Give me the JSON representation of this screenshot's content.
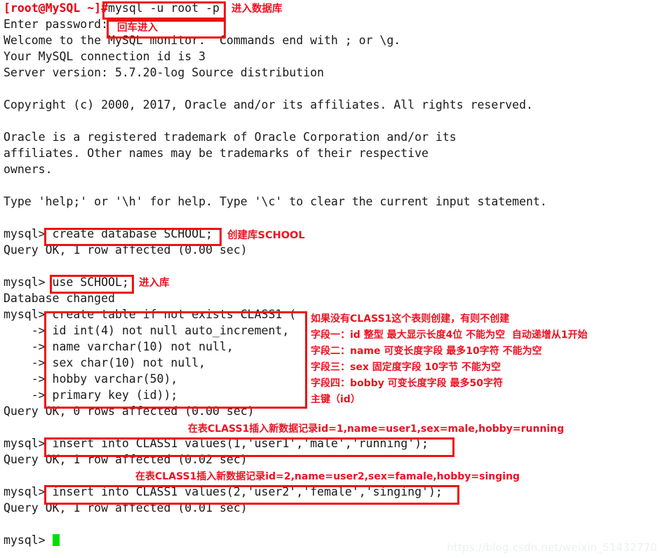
{
  "terminal": {
    "shell_prompt": "[root@MySQL ~]#",
    "mysql_prompt": "mysql>",
    "continuation_prompt": "    ->",
    "lines": [
      {
        "id": "l01",
        "pre": "[root@MySQL ~]#",
        "text": "mysql -u root -p"
      },
      {
        "id": "l02",
        "pre": "",
        "text": "Enter password:"
      },
      {
        "id": "l03",
        "pre": "",
        "text": "Welcome to the MySQL monitor.  Commands end with ; or \\g."
      },
      {
        "id": "l04",
        "pre": "",
        "text": "Your MySQL connection id is 3"
      },
      {
        "id": "l05",
        "pre": "",
        "text": "Server version: 5.7.20-log Source distribution"
      },
      {
        "id": "l06",
        "pre": "",
        "text": ""
      },
      {
        "id": "l07",
        "pre": "",
        "text": "Copyright (c) 2000, 2017, Oracle and/or its affiliates. All rights reserved."
      },
      {
        "id": "l08",
        "pre": "",
        "text": ""
      },
      {
        "id": "l09",
        "pre": "",
        "text": "Oracle is a registered trademark of Oracle Corporation and/or its"
      },
      {
        "id": "l10",
        "pre": "",
        "text": "affiliates. Other names may be trademarks of their respective"
      },
      {
        "id": "l11",
        "pre": "",
        "text": "owners."
      },
      {
        "id": "l12",
        "pre": "",
        "text": ""
      },
      {
        "id": "l13",
        "pre": "",
        "text": "Type 'help;' or '\\h' for help. Type '\\c' to clear the current input statement."
      },
      {
        "id": "l14",
        "pre": "",
        "text": ""
      },
      {
        "id": "l15",
        "pre": "",
        "text": "mysql> create database SCHOOL;"
      },
      {
        "id": "l16",
        "pre": "",
        "text": "Query OK, 1 row affected (0.00 sec)"
      },
      {
        "id": "l17",
        "pre": "",
        "text": ""
      },
      {
        "id": "l18",
        "pre": "",
        "text": "mysql> use SCHOOL;"
      },
      {
        "id": "l19",
        "pre": "",
        "text": "Database changed"
      },
      {
        "id": "l20",
        "pre": "",
        "text": "mysql> create table if not exists CLASS1 ("
      },
      {
        "id": "l21",
        "pre": "",
        "text": "    -> id int(4) not null auto_increment,"
      },
      {
        "id": "l22",
        "pre": "",
        "text": "    -> name varchar(10) not null,"
      },
      {
        "id": "l23",
        "pre": "",
        "text": "    -> sex char(10) not null,"
      },
      {
        "id": "l24",
        "pre": "",
        "text": "    -> hobby varchar(50),"
      },
      {
        "id": "l25",
        "pre": "",
        "text": "    -> primary key (id));"
      },
      {
        "id": "l26",
        "pre": "",
        "text": "Query OK, 0 rows affected (0.00 sec)"
      },
      {
        "id": "l27",
        "pre": "",
        "text": ""
      },
      {
        "id": "l28",
        "pre": "",
        "text": "mysql> insert into CLASS1 values(1,'user1','male','running');"
      },
      {
        "id": "l29",
        "pre": "",
        "text": "Query OK, 1 row affected (0.02 sec)"
      },
      {
        "id": "l30",
        "pre": "",
        "text": ""
      },
      {
        "id": "l31",
        "pre": "",
        "text": "mysql> insert into CLASS1 values(2,'user2','female','singing');"
      },
      {
        "id": "l32",
        "pre": "",
        "text": "Query OK, 1 row affected (0.01 sec)"
      },
      {
        "id": "l33",
        "pre": "",
        "text": ""
      },
      {
        "id": "l34",
        "pre": "",
        "text": "mysql> "
      }
    ]
  },
  "annotations": {
    "enter_db": "进入数据库",
    "press_enter": "回车进入",
    "create_db": "创建库SCHOOL",
    "enter_db_short": "进入库",
    "create_table_note": "如果没有CLASS1这个表则创建，有则不创建",
    "field_one": "字段一：id 整型 最大显示长度4位 不能为空  自动递增从1开始",
    "field_two": "字段二：name 可变长度字段 最多10字符 不能为空",
    "field_three": "字段三：sex 固定度字段 10字节 不能为空",
    "field_four": "字段四：bobby 可变长度字段 最多50字符",
    "primary_key": "主键（id）",
    "insert_one": "在表CLASS1插入新数据记录id=1,name=user1,sex=male,hobby=running",
    "insert_two": "在表CLASS1插入新数据记录id=2,name=user2,sex=famale,hobby=singing"
  },
  "watermark": {
    "url": "https://blog.csdn.net/weixin_51432770"
  },
  "colors": {
    "annotation_red": "#ee1122",
    "box_red": "#ee1111",
    "prompt_red": "#e8000d",
    "cursor_green": "#00e000",
    "text": "#1a1a1a"
  }
}
